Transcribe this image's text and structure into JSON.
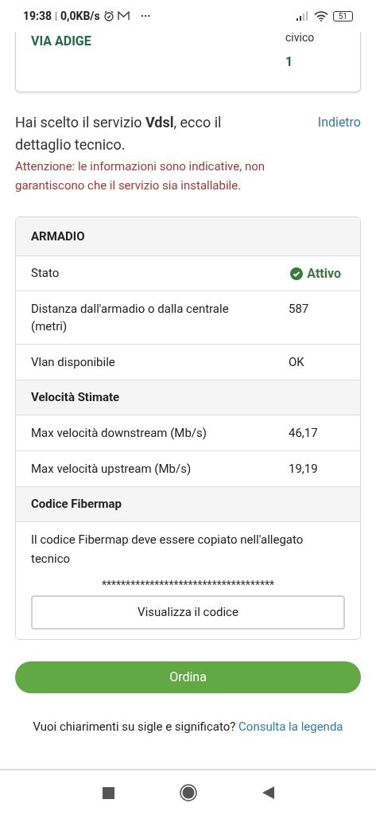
{
  "status_bar": {
    "time": "19:38",
    "separator": "|",
    "speed": "0,0KB/s",
    "more": "···",
    "battery": "51"
  },
  "address_card": {
    "street": "VIA ADIGE",
    "civico_label": "civico",
    "civico_value": "1"
  },
  "intro": {
    "text": "Hai scelto il servizio **Vdsl**, ecco il dettaglio tecnico.",
    "back_link": "Indietro",
    "warning": "Attenzione: le informazioni sono indicative, non garantiscono che il servizio sia installabile."
  },
  "details": [
    {
      "kind": "header",
      "label": "ARMADIO"
    },
    {
      "kind": "status",
      "label": "Stato",
      "value": "Attivo"
    },
    {
      "kind": "row",
      "label": "Distanza dall'armadio o dalla centrale (metri)",
      "value": "587"
    },
    {
      "kind": "row",
      "label": "Vlan disponibile",
      "value": "OK"
    },
    {
      "kind": "section",
      "label": "Velocità Stimate"
    },
    {
      "kind": "row",
      "label": "Max velocità downstream (Mb/s)",
      "value": "46,17"
    },
    {
      "kind": "row",
      "label": "Max velocità upstream (Mb/s)",
      "value": "19,19"
    },
    {
      "kind": "section",
      "label": "Codice Fibermap"
    },
    {
      "kind": "note",
      "label": "Il codice Fibermap deve essere copiato nell'allegato tecnico"
    }
  ],
  "code": {
    "masked": "************************************",
    "button": "Visualizza il codice"
  },
  "order_button": "Ordina",
  "footer": {
    "text": "Vuoi chiarimenti su sigle e significato?",
    "link": "Consulta la legenda"
  }
}
